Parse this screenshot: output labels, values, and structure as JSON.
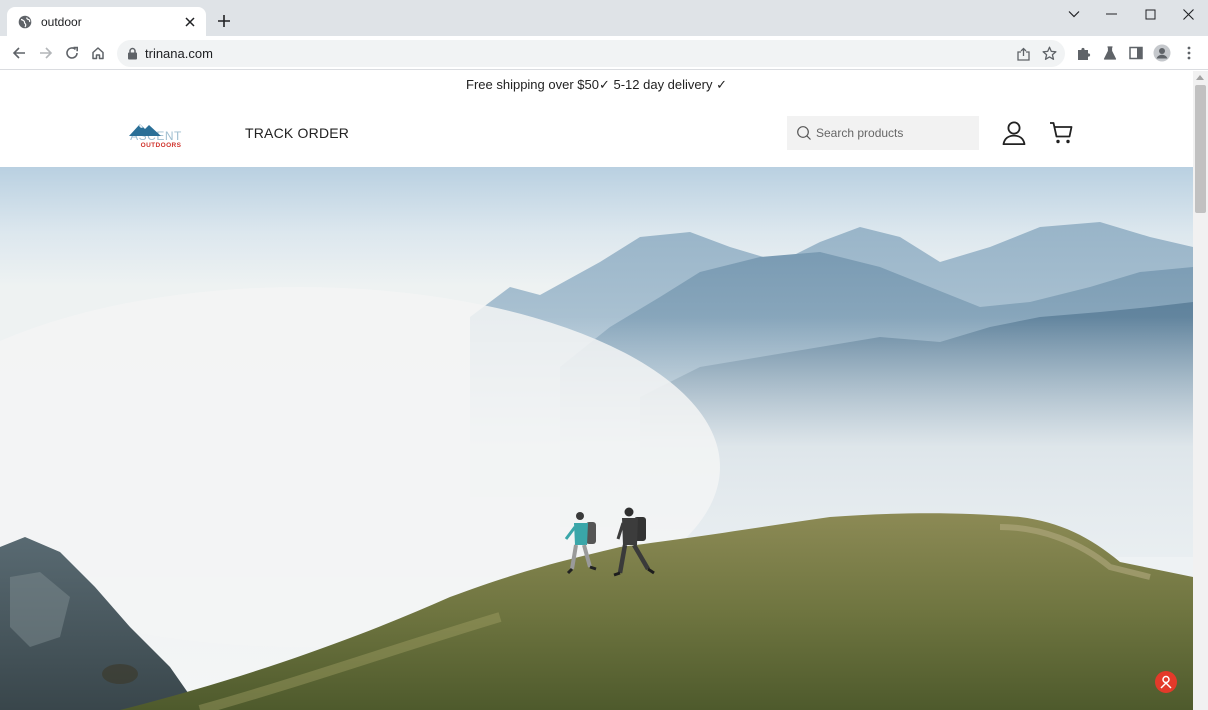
{
  "browser": {
    "tab_title": "outdoor",
    "url": "trinana.com"
  },
  "site": {
    "announcement": "Free shipping over $50✓ 5-12 day delivery ✓",
    "logo_top_text": "ASCENT",
    "logo_bottom_text": "OUTDOORS",
    "nav_track_order": "TRACK ORDER",
    "search_placeholder": "Search products"
  },
  "icons": {
    "favicon": "globe-icon",
    "tab_close": "close-icon",
    "new_tab": "plus-icon",
    "back": "back-arrow-icon",
    "forward": "forward-arrow-icon",
    "reload": "reload-icon",
    "home": "home-icon",
    "lock": "lock-icon",
    "share": "share-icon",
    "bookmark": "star-icon",
    "extensions": "puzzle-icon",
    "lab": "flask-icon",
    "side_panel": "side-panel-icon",
    "profile": "profile-icon",
    "menu": "kebab-menu-icon",
    "search": "search-icon",
    "account": "user-icon",
    "cart": "cart-icon",
    "help": "help-icon"
  },
  "colors": {
    "chrome_bg": "#dfe3e7",
    "omnibox_bg": "#f1f3f4",
    "search_bg": "#f2f2f2",
    "logo_blue": "#2a6f97",
    "logo_red": "#d0322b",
    "help_red": "#e33a2a"
  }
}
